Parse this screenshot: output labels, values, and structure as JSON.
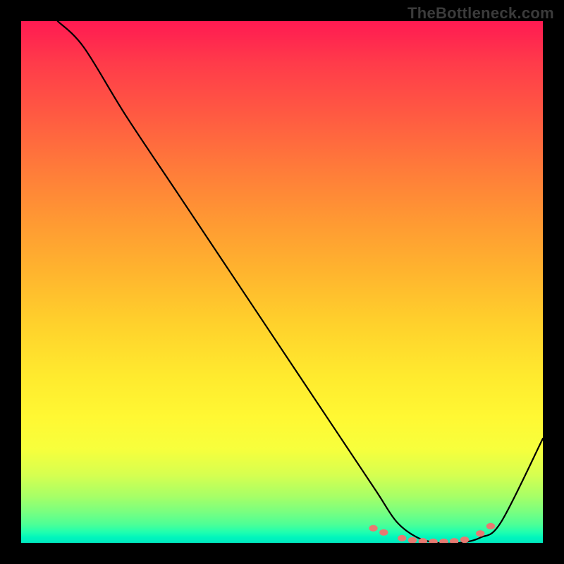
{
  "watermark": "TheBottleneck.com",
  "chart_data": {
    "type": "line",
    "title": "",
    "xlabel": "",
    "ylabel": "",
    "xlim": [
      0,
      100
    ],
    "ylim": [
      0,
      100
    ],
    "grid": false,
    "series": [
      {
        "name": "bottleneck-curve",
        "x": [
          7,
          12,
          20,
          30,
          40,
          50,
          60,
          68,
          72,
          76,
          80,
          84,
          88,
          92,
          100
        ],
        "y": [
          100,
          95,
          82,
          67,
          52,
          37,
          22,
          10,
          4,
          1,
          0,
          0,
          1,
          4,
          20
        ],
        "color": "#000000"
      }
    ],
    "markers": {
      "name": "flat-region-dots",
      "x": [
        67.5,
        69.5,
        73,
        75,
        77,
        79,
        81,
        83,
        85,
        88,
        90
      ],
      "y": [
        2.8,
        2.0,
        0.9,
        0.5,
        0.3,
        0.2,
        0.2,
        0.3,
        0.6,
        1.8,
        3.2
      ],
      "color": "#e77a72"
    }
  }
}
